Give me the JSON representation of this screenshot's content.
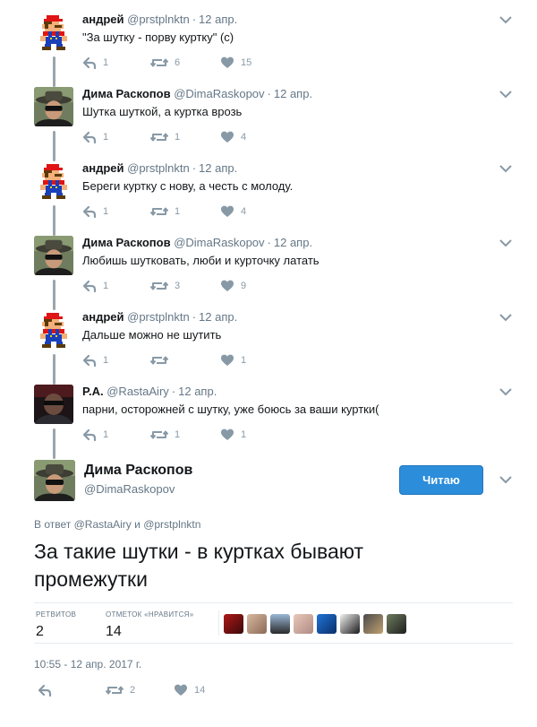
{
  "thread": [
    {
      "name": "андрей",
      "handle": "@prstplnktn",
      "time": "12 апр.",
      "text": "\"За шутку - порву куртку\" (с)",
      "replies": "1",
      "retweets": "6",
      "likes": "15",
      "avatar": "mario"
    },
    {
      "name": "Дима Раскопов",
      "handle": "@DimaRaskopov",
      "time": "12 апр.",
      "text": "Шутка шуткой, а куртка врозь",
      "replies": "1",
      "retweets": "1",
      "likes": "4",
      "avatar": "dima"
    },
    {
      "name": "андрей",
      "handle": "@prstplnktn",
      "time": "12 апр.",
      "text": "Береги куртку с нову, а честь с молоду.",
      "replies": "1",
      "retweets": "1",
      "likes": "4",
      "avatar": "mario"
    },
    {
      "name": "Дима Раскопов",
      "handle": "@DimaRaskopov",
      "time": "12 апр.",
      "text": "Любишь шутковать, люби и курточку латать",
      "replies": "1",
      "retweets": "3",
      "likes": "9",
      "avatar": "dima"
    },
    {
      "name": "андрей",
      "handle": "@prstplnktn",
      "time": "12 апр.",
      "text": "Дальше можно не шутить",
      "replies": "1",
      "retweets": "",
      "likes": "1",
      "avatar": "mario"
    },
    {
      "name": "P.A.",
      "handle": "@RastaAiry",
      "time": "12 апр.",
      "text": "парни, осторожней с шутку, уже боюсь за ваши куртки(",
      "replies": "1",
      "retweets": "1",
      "likes": "1",
      "avatar": "rasta"
    }
  ],
  "main": {
    "name": "Дима Раскопов",
    "handle": "@DimaRaskopov",
    "follow_label": "Читаю",
    "replying_prefix": "В ответ",
    "replying_to_1": "@RastaAiry",
    "replying_and": "и",
    "replying_to_2": "@prstplnktn",
    "text": "За такие шутки - в куртках бывают промежутки",
    "retweets_label": "РЕТВИТОВ",
    "retweets_count": "2",
    "likes_label": "ОТМЕТОК «НРАВИТСЯ»",
    "likes_count": "14",
    "timestamp": "10:55 - 12 апр. 2017 г.",
    "bottom_retweets": "2",
    "bottom_likes": "14"
  },
  "colors": {
    "accent": "#2c8ddb",
    "muted": "#657786",
    "icon": "#8899a6"
  },
  "icons": {
    "reply": "reply-icon",
    "retweet": "retweet-icon",
    "like": "heart-icon",
    "more": "chevron-down-icon"
  }
}
